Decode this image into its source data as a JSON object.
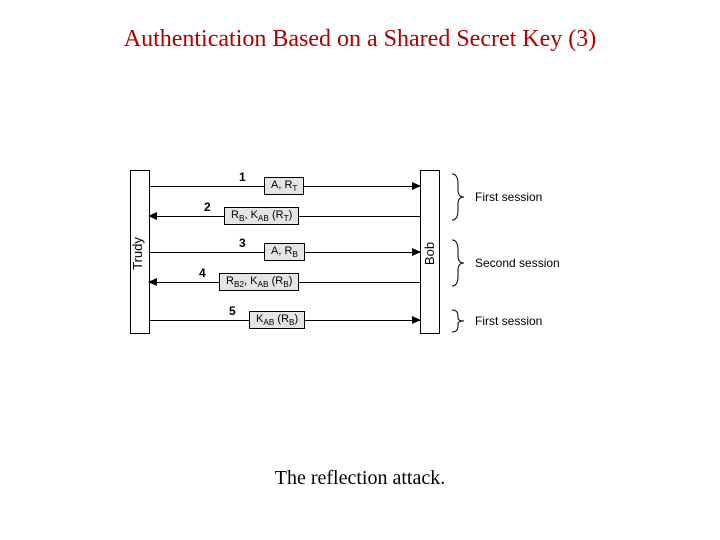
{
  "title": "Authentication Based on a Shared Secret Key (3)",
  "caption": "The reflection attack.",
  "parties": {
    "left": "Trudy",
    "right": "Bob"
  },
  "messages": [
    {
      "num": "1",
      "payload_html": "A, R<span class='sub'>T</span>",
      "dir": "right"
    },
    {
      "num": "2",
      "payload_html": "R<span class='sub'>B</span>, K<span class='sub'>AB</span> (R<span class='sub'>T</span>)",
      "dir": "left"
    },
    {
      "num": "3",
      "payload_html": "A, R<span class='sub'>B</span>",
      "dir": "right"
    },
    {
      "num": "4",
      "payload_html": "R<span class='sub'>B2</span>, K<span class='sub'>AB</span> (R<span class='sub'>B</span>)",
      "dir": "left"
    },
    {
      "num": "5",
      "payload_html": "K<span class='sub'>AB</span> (R<span class='sub'>B</span>)",
      "dir": "right"
    }
  ],
  "sessions": [
    {
      "label": "First session",
      "covers": [
        1,
        2
      ]
    },
    {
      "label": "Second session",
      "covers": [
        3,
        4
      ]
    },
    {
      "label": "First session",
      "covers": [
        5,
        5
      ]
    }
  ]
}
